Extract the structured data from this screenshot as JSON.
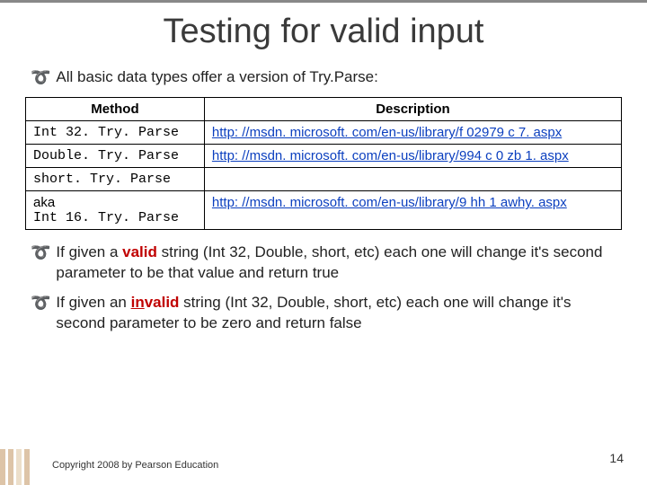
{
  "title": "Testing for valid input",
  "intro": "All basic data types offer a version of Try.Parse:",
  "table": {
    "headers": [
      "Method",
      "Description"
    ],
    "rows": [
      {
        "method": "Int 32. Try. Parse",
        "aka": "",
        "link": "http: //msdn. microsoft. com/en-us/library/f 02979 c 7. aspx"
      },
      {
        "method": "Double. Try. Parse",
        "aka": "",
        "link": "http: //msdn. microsoft. com/en-us/library/994 c 0 zb 1. aspx"
      },
      {
        "method": "short. Try. Parse",
        "aka": "",
        "link": ""
      },
      {
        "method": "Int 16. Try. Parse",
        "aka": "aka",
        "link": "http: //msdn. microsoft. com/en-us/library/9 hh 1 awhy. aspx"
      }
    ]
  },
  "bullets": {
    "b1_pre": "If given a ",
    "b1_valid": "valid",
    "b1_post": " string (Int 32, Double, short, etc) each one will change it's second parameter to be that value and return true",
    "b2_pre": "If given an ",
    "b2_invalid": "in",
    "b2_mid": "valid",
    "b2_post": " string (Int 32, Double, short, etc) each one will change it's second parameter to be zero and return false"
  },
  "slide_number": "14",
  "copyright": "Copyright 2008 by Pearson Education"
}
